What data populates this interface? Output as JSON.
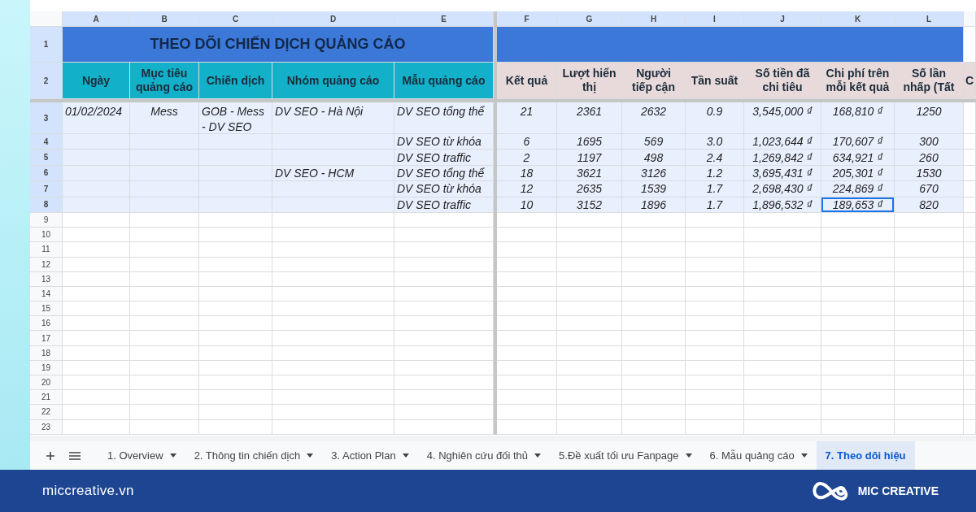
{
  "columns": [
    {
      "letter": "A",
      "selected": true
    },
    {
      "letter": "B",
      "selected": true
    },
    {
      "letter": "C",
      "selected": true
    },
    {
      "letter": "D",
      "selected": true
    },
    {
      "letter": "E",
      "selected": true
    },
    {
      "letter": "F",
      "selected": true
    },
    {
      "letter": "G",
      "selected": true
    },
    {
      "letter": "H",
      "selected": true
    },
    {
      "letter": "I",
      "selected": true
    },
    {
      "letter": "J",
      "selected": true
    },
    {
      "letter": "K",
      "selected": true
    },
    {
      "letter": "L",
      "selected": true
    },
    {
      "selected": false
    }
  ],
  "row_numbers": [
    {
      "label": "1",
      "selected": true
    },
    {
      "label": "2",
      "selected": true
    },
    {
      "label": "3",
      "selected": true
    },
    {
      "label": "4",
      "selected": true
    },
    {
      "label": "5",
      "selected": true
    },
    {
      "label": "6",
      "selected": true
    },
    {
      "label": "7",
      "selected": true
    },
    {
      "label": "8",
      "selected": true
    },
    {
      "label": "9",
      "selected": false
    },
    {
      "label": "10",
      "selected": false
    },
    {
      "label": "11",
      "selected": false
    },
    {
      "label": "12",
      "selected": false
    },
    {
      "label": "13",
      "selected": false
    },
    {
      "label": "14",
      "selected": false
    },
    {
      "label": "15",
      "selected": false
    },
    {
      "label": "16",
      "selected": false
    },
    {
      "label": "17",
      "selected": false
    },
    {
      "label": "18",
      "selected": false
    },
    {
      "label": "19",
      "selected": false
    },
    {
      "label": "20",
      "selected": false
    },
    {
      "label": "21",
      "selected": false
    },
    {
      "label": "22",
      "selected": false
    },
    {
      "label": "23",
      "selected": false
    }
  ],
  "title": "THEO DÕI CHIẾN DỊCH QUẢNG CÁO",
  "headers": [
    {
      "kind": "dimension",
      "text": "Ngày"
    },
    {
      "kind": "dimension",
      "text": "Mục tiêu quảng cáo"
    },
    {
      "kind": "dimension",
      "text": "Chiến dịch"
    },
    {
      "kind": "dimension",
      "text": "Nhóm quảng cáo"
    },
    {
      "kind": "dimension",
      "text": "Mẫu quảng cáo"
    },
    {
      "kind": "metric",
      "text": "Kết quả"
    },
    {
      "kind": "metric",
      "text": "Lượt hiển thị"
    },
    {
      "kind": "metric",
      "text": "Người tiếp cận"
    },
    {
      "kind": "metric",
      "text": "Tần suất"
    },
    {
      "kind": "metric",
      "text": "Số tiền đã chi tiêu"
    },
    {
      "kind": "metric",
      "text": "Chi phí trên mỗi kết quả"
    },
    {
      "kind": "metric",
      "text": "Số lần nhấp (Tất"
    },
    {
      "kind": "metric",
      "text": "C"
    }
  ],
  "rows": [
    {
      "cells": [
        {
          "text": "01/02/2024",
          "selected": false
        },
        {
          "text": "Mess",
          "selected": false
        },
        {
          "text": "GOB - Mess - DV SEO",
          "selected": false
        },
        {
          "text": "DV SEO - Hà Nội",
          "selected": false
        },
        {
          "text": "DV SEO tổng thể",
          "selected": false
        },
        {
          "text": "21",
          "selected": false
        },
        {
          "text": "2361",
          "selected": false
        },
        {
          "text": "2632",
          "selected": false
        },
        {
          "text": "0.9",
          "selected": false
        },
        {
          "text": "3,545,000 ₫",
          "selected": false
        },
        {
          "text": "168,810 ₫",
          "selected": false
        },
        {
          "text": "1250",
          "selected": false
        },
        {}
      ]
    },
    {
      "cells": [
        {
          "selected": false
        },
        {
          "selected": false
        },
        {
          "selected": false
        },
        {
          "selected": false
        },
        {
          "text": "DV SEO từ khóa",
          "selected": false
        },
        {
          "text": "6",
          "selected": false
        },
        {
          "text": "1695",
          "selected": false
        },
        {
          "text": "569",
          "selected": false
        },
        {
          "text": "3.0",
          "selected": false
        },
        {
          "text": "1,023,644 ₫",
          "selected": false
        },
        {
          "text": "170,607 ₫",
          "selected": false
        },
        {
          "text": "300",
          "selected": false
        },
        {}
      ]
    },
    {
      "cells": [
        {
          "selected": false
        },
        {
          "selected": false
        },
        {
          "selected": false
        },
        {
          "selected": false
        },
        {
          "text": "DV SEO traffic",
          "selected": false
        },
        {
          "text": "2",
          "selected": false
        },
        {
          "text": "1197",
          "selected": false
        },
        {
          "text": "498",
          "selected": false
        },
        {
          "text": "2.4",
          "selected": false
        },
        {
          "text": "1,269,842 ₫",
          "selected": false
        },
        {
          "text": "634,921 ₫",
          "selected": false
        },
        {
          "text": "260",
          "selected": false
        },
        {}
      ]
    },
    {
      "cells": [
        {
          "selected": false
        },
        {
          "selected": false
        },
        {
          "selected": false
        },
        {
          "text": "DV SEO - HCM",
          "selected": false
        },
        {
          "text": "DV SEO tổng thể",
          "selected": false
        },
        {
          "text": "18",
          "selected": false
        },
        {
          "text": "3621",
          "selected": false
        },
        {
          "text": "3126",
          "selected": false
        },
        {
          "text": "1.2",
          "selected": false
        },
        {
          "text": "3,695,431 ₫",
          "selected": false
        },
        {
          "text": "205,301 ₫",
          "selected": false
        },
        {
          "text": "1530",
          "selected": false
        },
        {}
      ]
    },
    {
      "cells": [
        {
          "selected": false
        },
        {
          "selected": false
        },
        {
          "selected": false
        },
        {
          "selected": false
        },
        {
          "text": "DV SEO từ khóa",
          "selected": false
        },
        {
          "text": "12",
          "selected": false
        },
        {
          "text": "2635",
          "selected": false
        },
        {
          "text": "1539",
          "selected": false
        },
        {
          "text": "1.7",
          "selected": false
        },
        {
          "text": "2,698,430 ₫",
          "selected": false
        },
        {
          "text": "224,869 ₫",
          "selected": false
        },
        {
          "text": "670",
          "selected": false
        },
        {}
      ]
    },
    {
      "cells": [
        {
          "selected": false
        },
        {
          "selected": false
        },
        {
          "selected": false
        },
        {
          "selected": false
        },
        {
          "text": "DV SEO traffic",
          "selected": false
        },
        {
          "text": "10",
          "selected": false
        },
        {
          "text": "3152",
          "selected": false
        },
        {
          "text": "1896",
          "selected": false
        },
        {
          "text": "1.7",
          "selected": false
        },
        {
          "text": "1,896,532 ₫",
          "selected": false
        },
        {
          "text": "189,653 ₫",
          "selected": true
        },
        {
          "text": "820",
          "selected": false
        },
        {}
      ]
    }
  ],
  "tabs": [
    {
      "label": "1. Overview",
      "selected": false
    },
    {
      "label": "2. Thông tin chiến dịch",
      "selected": false
    },
    {
      "label": "3. Action Plan",
      "selected": false
    },
    {
      "label": "4. Nghiên cứu đối thủ",
      "selected": false
    },
    {
      "label": "5.Đề xuất tối ưu Fanpage",
      "selected": false
    },
    {
      "label": "6. Mẫu quảng cáo",
      "selected": false
    },
    {
      "label": "7. Theo dõi hiệu",
      "selected": true
    }
  ],
  "footer": {
    "website": "miccreative.vn",
    "brand": "MIC CREATIVE"
  }
}
